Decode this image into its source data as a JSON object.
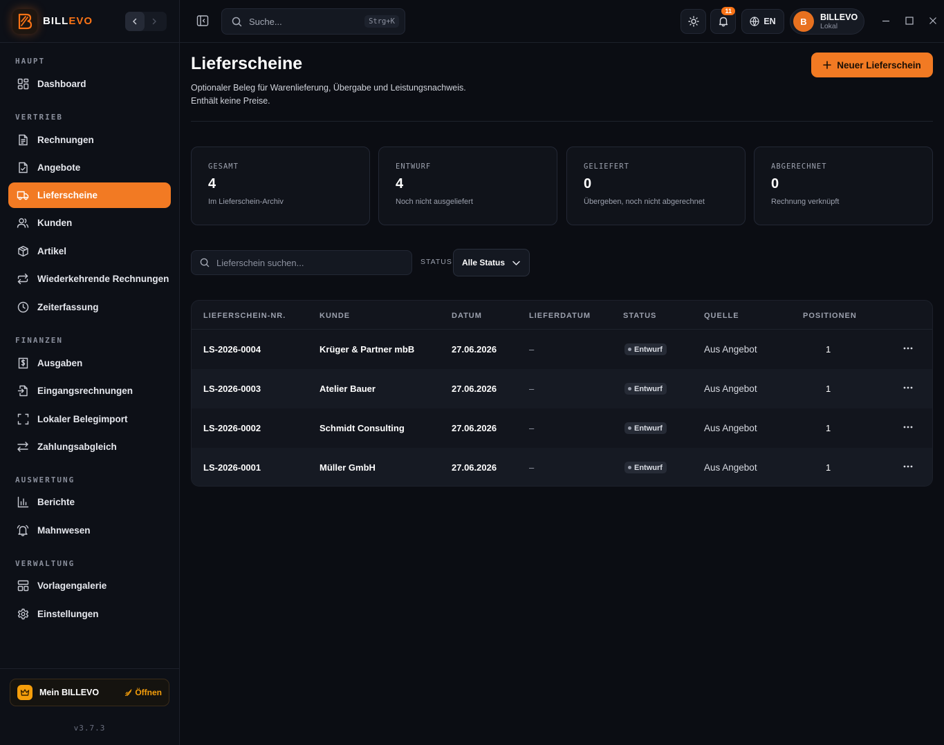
{
  "brand": {
    "name_part1": "BILL",
    "name_part2": "EVO"
  },
  "sidebar": {
    "sections": [
      {
        "label": "HAUPT"
      },
      {
        "label": "VERTRIEB"
      },
      {
        "label": "FINANZEN"
      },
      {
        "label": "AUSWERTUNG"
      },
      {
        "label": "VERWALTUNG"
      }
    ],
    "items": [
      {
        "label": "Dashboard",
        "icon": "dashboard-icon"
      },
      {
        "label": "Rechnungen",
        "icon": "invoice-icon"
      },
      {
        "label": "Angebote",
        "icon": "offer-icon"
      },
      {
        "label": "Lieferscheine",
        "icon": "truck-icon",
        "active": true
      },
      {
        "label": "Kunden",
        "icon": "users-icon"
      },
      {
        "label": "Artikel",
        "icon": "box-icon"
      },
      {
        "label": "Wiederkehrende Rechnungen",
        "icon": "repeat-icon"
      },
      {
        "label": "Zeiterfassung",
        "icon": "clock-icon"
      },
      {
        "label": "Ausgaben",
        "icon": "expense-icon"
      },
      {
        "label": "Eingangsrechnungen",
        "icon": "incoming-invoice-icon"
      },
      {
        "label": "Lokaler Belegimport",
        "icon": "scan-icon"
      },
      {
        "label": "Zahlungsabgleich",
        "icon": "arrows-icon"
      },
      {
        "label": "Berichte",
        "icon": "chart-icon"
      },
      {
        "label": "Mahnwesen",
        "icon": "bell-icon"
      },
      {
        "label": "Vorlagengalerie",
        "icon": "template-icon"
      },
      {
        "label": "Einstellungen",
        "icon": "gear-icon"
      }
    ],
    "my_billevo": {
      "label": "Mein BILLEVO",
      "open": "Öffnen"
    },
    "version": "v3.7.3"
  },
  "topbar": {
    "search_placeholder": "Suche...",
    "search_shortcut": "Strg+K",
    "notification_count": "11",
    "language": "EN",
    "user": {
      "initial": "B",
      "name": "BILLEVO",
      "sub": "Lokal"
    }
  },
  "page": {
    "title": "Lieferscheine",
    "description_line1": "Optionaler Beleg für Warenlieferung, Übergabe und Leistungsnachweis.",
    "description_line2": "Enthält keine Preise.",
    "new_button": "Neuer Lieferschein"
  },
  "stats": [
    {
      "key": "GESAMT",
      "value": "4",
      "sub": "Im Lieferschein-Archiv"
    },
    {
      "key": "ENTWURF",
      "value": "4",
      "sub": "Noch nicht ausgeliefert"
    },
    {
      "key": "GELIEFERT",
      "value": "0",
      "sub": "Übergeben, noch nicht abgerechnet"
    },
    {
      "key": "ABGERECHNET",
      "value": "0",
      "sub": "Rechnung verknüpft"
    }
  ],
  "filters": {
    "search_placeholder": "Lieferschein suchen...",
    "status_label": "STATUS",
    "status_value": "Alle Status"
  },
  "table": {
    "columns": [
      "LIEFERSCHEIN-NR.",
      "KUNDE",
      "DATUM",
      "LIEFERDATUM",
      "STATUS",
      "QUELLE",
      "POSITIONEN"
    ],
    "rows": [
      {
        "nr": "LS-2026-0004",
        "kunde": "Krüger & Partner mbB",
        "datum": "27.06.2026",
        "lieferdatum": "–",
        "status": "Entwurf",
        "quelle": "Aus Angebot",
        "positionen": "1"
      },
      {
        "nr": "LS-2026-0003",
        "kunde": "Atelier Bauer",
        "datum": "27.06.2026",
        "lieferdatum": "–",
        "status": "Entwurf",
        "quelle": "Aus Angebot",
        "positionen": "1"
      },
      {
        "nr": "LS-2026-0002",
        "kunde": "Schmidt Consulting",
        "datum": "27.06.2026",
        "lieferdatum": "–",
        "status": "Entwurf",
        "quelle": "Aus Angebot",
        "positionen": "1"
      },
      {
        "nr": "LS-2026-0001",
        "kunde": "Müller GmbH",
        "datum": "27.06.2026",
        "lieferdatum": "–",
        "status": "Entwurf",
        "quelle": "Aus Angebot",
        "positionen": "1"
      }
    ]
  },
  "colors": {
    "accent": "#f27a23",
    "background": "#0b0d13",
    "sidebar": "#0d1017"
  }
}
